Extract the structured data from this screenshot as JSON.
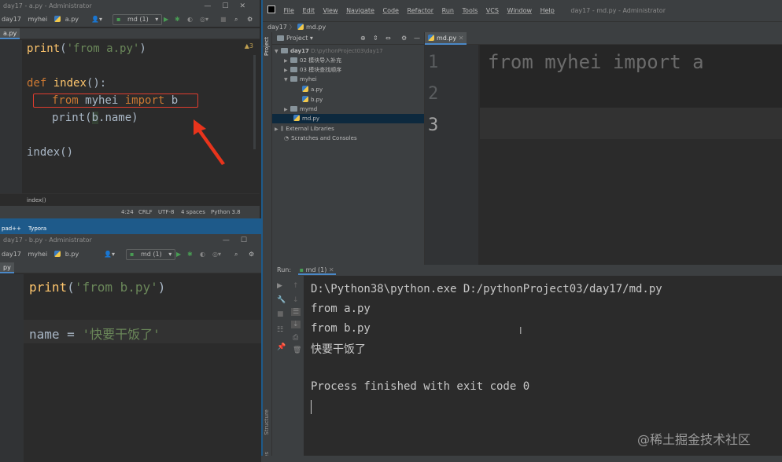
{
  "left_top": {
    "title": "day17 - a.py - Administrator",
    "nav": [
      "day17",
      "myhei",
      "a.py"
    ],
    "run_config": "md (1)",
    "tab": "a.py",
    "warnings": "▲3",
    "code": {
      "l1": {
        "fn": "print",
        "paren": "(",
        "str": "'from a.py'",
        "close": ")"
      },
      "l2": {
        "kw": "def",
        "name": "index",
        "rest": "():"
      },
      "l3": {
        "kw1": "from",
        "mod": " myhei ",
        "kw2": "import",
        "rest": " b"
      },
      "l4": {
        "a": "print(",
        "b": "b",
        "c": ".name)"
      },
      "l5": "index()"
    },
    "breadcrumb": "index()",
    "status": {
      "pos": "4:24",
      "crlf": "CRLF",
      "enc": "UTF-8",
      "indent": "4 spaces",
      "python": "Python 3.8"
    }
  },
  "taskbar": {
    "a": "pad++",
    "b": "Typora"
  },
  "left_bottom": {
    "title": "day17 - b.py - Administrator",
    "nav": [
      "day17",
      "myhei",
      "b.py"
    ],
    "run_config": "md (1)",
    "tab": "py",
    "code": {
      "l1": {
        "fn": "print",
        "paren": "(",
        "str": "'from b.py'",
        "close": ")"
      },
      "l2": {
        "name": "name",
        "op": " = ",
        "str": "'快要干饭了'"
      }
    }
  },
  "right": {
    "title": "day17 - md.py - Administrator",
    "menu": [
      "File",
      "Edit",
      "View",
      "Navigate",
      "Code",
      "Refactor",
      "Run",
      "Tools",
      "VCS",
      "Window",
      "Help"
    ],
    "breadcrumb": [
      "day17",
      "md.py"
    ],
    "project_label": "Project",
    "project_side_label": "Project",
    "editor_tab": "md.py",
    "tree": {
      "root": "day17",
      "root_path": "D:\\pythonProject03\\day17",
      "f1": "02 模块导入补充",
      "f2": "03 模块查找顺序",
      "f3": "myhei",
      "f3a": "a.py",
      "f3b": "b.py",
      "f4": "mymd",
      "f5": "md.py",
      "ext": "External Libraries",
      "scratch": "Scratches and Consoles"
    },
    "line_numbers": [
      "1",
      "2",
      "3"
    ],
    "editor_code": "from myhei import a",
    "run_label": "Run:",
    "run_tab": "md (1)",
    "console": {
      "cmd": "D:\\Python38\\python.exe D:/pythonProject03/day17/md.py",
      "out1": "from a.py",
      "out2": "from b.py",
      "out3": "快要干饭了",
      "finish": "Process finished with exit code 0"
    },
    "structure_label": "Structure",
    "favorites_label": "Favorites"
  },
  "watermark": "@稀土掘金技术社区"
}
